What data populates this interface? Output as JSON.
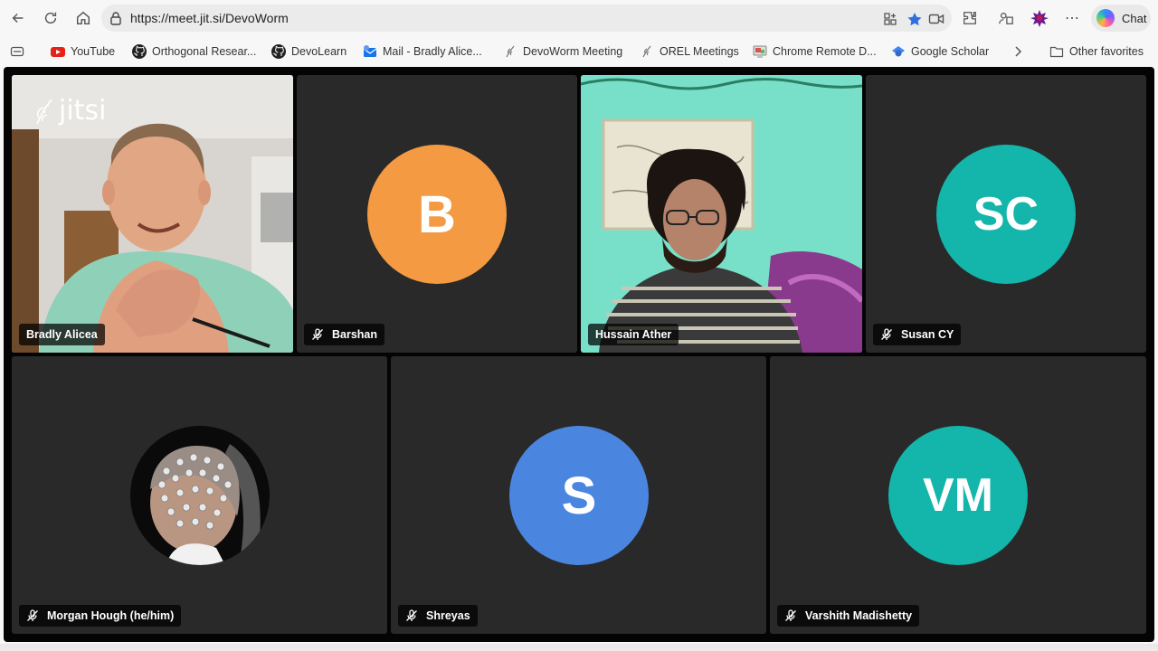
{
  "browser": {
    "url": "https://meet.jit.si/DevoWorm",
    "chat_label": "Chat",
    "bookmarks": [
      {
        "label": "YouTube",
        "icon": "youtube-icon"
      },
      {
        "label": "Orthogonal Resear...",
        "icon": "github-icon"
      },
      {
        "label": "DevoLearn",
        "icon": "github-icon"
      },
      {
        "label": "Mail - Bradly Alice...",
        "icon": "mail-icon"
      },
      {
        "label": "DevoWorm Meeting",
        "icon": "jitsi-icon"
      },
      {
        "label": "OREL Meetings",
        "icon": "jitsi-icon"
      },
      {
        "label": "Chrome Remote D...",
        "icon": "remote-desktop-icon"
      },
      {
        "label": "Google Scholar",
        "icon": "scholar-icon"
      }
    ],
    "other_favorites": "Other favorites"
  },
  "meeting": {
    "watermark": "jitsi",
    "participants": [
      {
        "name": "Bradly Alicea",
        "type": "video",
        "muted": false
      },
      {
        "name": "Barshan",
        "type": "avatar",
        "initials": "B",
        "color": "#f39a43",
        "muted": true
      },
      {
        "name": "Hussain Ather",
        "type": "video",
        "muted": false,
        "active_speaker": true
      },
      {
        "name": "Susan CY",
        "type": "avatar",
        "initials": "SC",
        "color": "#14b5aa",
        "muted": true
      },
      {
        "name": "Morgan Hough (he/him)",
        "type": "photo",
        "muted": true
      },
      {
        "name": "Shreyas",
        "type": "avatar",
        "initials": "S",
        "color": "#4a86e0",
        "muted": true
      },
      {
        "name": "Varshith Madishetty",
        "type": "avatar",
        "initials": "VM",
        "color": "#14b5aa",
        "muted": true
      }
    ]
  }
}
